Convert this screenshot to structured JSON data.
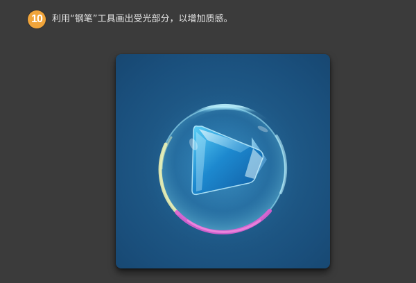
{
  "step": {
    "number": "10",
    "instruction": "利用“钢笔”工具画出受光部分，以增加质感。"
  },
  "colors": {
    "page_background": "#3b3b3b",
    "badge": "#f0a43a",
    "panel_background": "#1f5a88"
  },
  "artwork": {
    "icon_name": "glass-bubble-play-icon"
  }
}
